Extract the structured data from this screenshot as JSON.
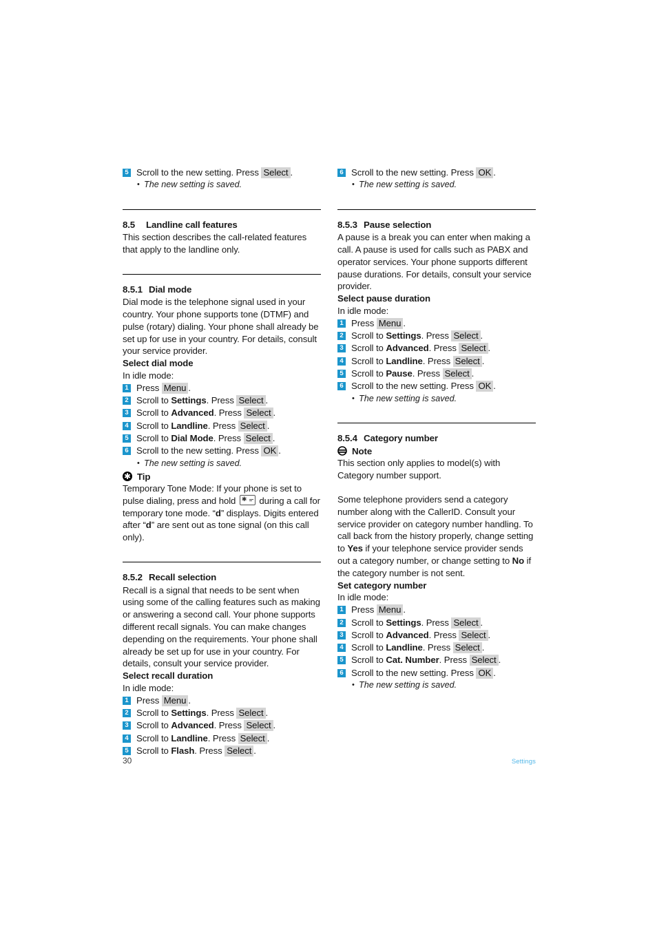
{
  "footer": {
    "page_number": "30",
    "section_label": "Settings"
  },
  "left_column": {
    "top_step": {
      "num": "5",
      "text_before": "Scroll to the new setting. Press",
      "key": "Select",
      "text_after": ".",
      "bullet": "The new setting is saved."
    },
    "section_8_5": {
      "number": "8.5",
      "title": "Landline call features",
      "body": "This section describes the call-related features that apply to the landline only."
    },
    "section_8_5_1": {
      "number": "8.5.1",
      "title": "Dial mode",
      "body": "Dial mode is the telephone signal used in your country. Your phone supports tone (DTMF) and pulse (rotary) dialing. Your phone shall already be set up for use in your country. For details, consult your service provider.",
      "sub_head": "Select dial mode",
      "idle": "In idle mode:",
      "steps": [
        {
          "num": "1",
          "pre": "Press",
          "bold": "",
          "mid": "",
          "key": "Menu",
          "post": "."
        },
        {
          "num": "2",
          "pre": "Scroll to",
          "bold": "Settings",
          "mid": ". Press",
          "key": "Select",
          "post": "."
        },
        {
          "num": "3",
          "pre": "Scroll to",
          "bold": "Advanced",
          "mid": ". Press",
          "key": "Select",
          "post": "."
        },
        {
          "num": "4",
          "pre": "Scroll to",
          "bold": "Landline",
          "mid": ". Press",
          "key": "Select",
          "post": "."
        },
        {
          "num": "5",
          "pre": "Scroll to",
          "bold": "Dial Mode",
          "mid": ". Press",
          "key": "Select",
          "post": "."
        },
        {
          "num": "6",
          "pre": "Scroll to the new setting. Press",
          "bold": "",
          "mid": "",
          "key": "OK",
          "post": "."
        }
      ],
      "bullet": "The new setting is saved.",
      "tip": {
        "label": "Tip",
        "icon": "asterisk-circle-icon",
        "text_part1": "Temporary Tone Mode: If your phone is set to pulse dialing, press and hold",
        "inline_icon": "star-key-icon",
        "text_part2": "during a call for temporary tone mode. “",
        "bold1": "d",
        "text_part3": "” displays. Digits entered after “",
        "bold2": "d",
        "text_part4": "” are sent out as tone signal (on this call only)."
      }
    },
    "section_8_5_2": {
      "number": "8.5.2",
      "title": "Recall selection",
      "body": "Recall is a signal that needs to be sent when using some of the calling features such as making or answering a second call. Your phone supports different recall signals. You can make changes depending on the requirements. Your phone shall already be set up for use in your country. For details, consult your service provider.",
      "sub_head": "Select recall duration",
      "idle": "In idle mode:",
      "steps": [
        {
          "num": "1",
          "pre": "Press",
          "bold": "",
          "mid": "",
          "key": "Menu",
          "post": "."
        },
        {
          "num": "2",
          "pre": "Scroll to",
          "bold": "Settings",
          "mid": ". Press",
          "key": "Select",
          "post": "."
        },
        {
          "num": "3",
          "pre": "Scroll to",
          "bold": "Advanced",
          "mid": ". Press",
          "key": "Select",
          "post": "."
        },
        {
          "num": "4",
          "pre": "Scroll to",
          "bold": "Landline",
          "mid": ". Press",
          "key": "Select",
          "post": "."
        },
        {
          "num": "5",
          "pre": "Scroll to",
          "bold": "Flash",
          "mid": ". Press",
          "key": "Select",
          "post": "."
        }
      ]
    }
  },
  "right_column": {
    "top_step": {
      "num": "6",
      "text_before": "Scroll to the new setting. Press",
      "key": "OK",
      "text_after": ".",
      "bullet": "The new setting is saved."
    },
    "section_8_5_3": {
      "number": "8.5.3",
      "title": "Pause selection",
      "body": "A pause is a break you can enter when making a call. A pause is used for calls such as PABX and operator services. Your phone supports different pause durations. For details, consult your service provider.",
      "sub_head": "Select pause duration",
      "idle": "In idle mode:",
      "steps": [
        {
          "num": "1",
          "pre": "Press",
          "bold": "",
          "mid": "",
          "key": "Menu",
          "post": "."
        },
        {
          "num": "2",
          "pre": "Scroll to",
          "bold": "Settings",
          "mid": ". Press",
          "key": "Select",
          "post": "."
        },
        {
          "num": "3",
          "pre": "Scroll to",
          "bold": "Advanced",
          "mid": ". Press",
          "key": "Select",
          "post": "."
        },
        {
          "num": "4",
          "pre": "Scroll to",
          "bold": "Landline",
          "mid": ". Press",
          "key": "Select",
          "post": "."
        },
        {
          "num": "5",
          "pre": "Scroll to",
          "bold": "Pause",
          "mid": ". Press",
          "key": "Select",
          "post": "."
        },
        {
          "num": "6",
          "pre": "Scroll to the new setting. Press",
          "bold": "",
          "mid": "",
          "key": "OK",
          "post": "."
        }
      ],
      "bullet": "The new setting is saved."
    },
    "section_8_5_4": {
      "number": "8.5.4",
      "title": "Category number",
      "note": {
        "label": "Note",
        "icon": "note-circle-icon",
        "body": "This section only applies to model(s) with Category number support."
      },
      "body_part1": "Some telephone providers send a category number along with the CallerID. Consult your service provider on category number handling. To call back from the history properly, change setting to ",
      "bold1": "Yes",
      "body_part2": " if your telephone service provider sends out a category number, or change setting to ",
      "bold2": "No",
      "body_part3": " if the category number is not sent.",
      "sub_head": "Set category number",
      "idle": "In idle mode:",
      "steps": [
        {
          "num": "1",
          "pre": "Press",
          "bold": "",
          "mid": "",
          "key": "Menu",
          "post": "."
        },
        {
          "num": "2",
          "pre": "Scroll to",
          "bold": "Settings",
          "mid": ". Press",
          "key": "Select",
          "post": "."
        },
        {
          "num": "3",
          "pre": "Scroll to",
          "bold": "Advanced",
          "mid": ". Press",
          "key": "Select",
          "post": "."
        },
        {
          "num": "4",
          "pre": "Scroll to",
          "bold": "Landline",
          "mid": ". Press",
          "key": "Select",
          "post": "."
        },
        {
          "num": "5",
          "pre": "Scroll to",
          "bold": "Cat. Number",
          "mid": ". Press",
          "key": "Select",
          "post": "."
        },
        {
          "num": "6",
          "pre": "Scroll to the new setting. Press",
          "bold": "",
          "mid": "",
          "key": "OK",
          "post": "."
        }
      ],
      "bullet": "The new setting is saved."
    }
  },
  "colors": {
    "badge_blue": "#1b95cc",
    "key_chip_gray": "#d4d4d4",
    "footer_blue": "#53b7e8",
    "text": "#1a1a1a"
  }
}
